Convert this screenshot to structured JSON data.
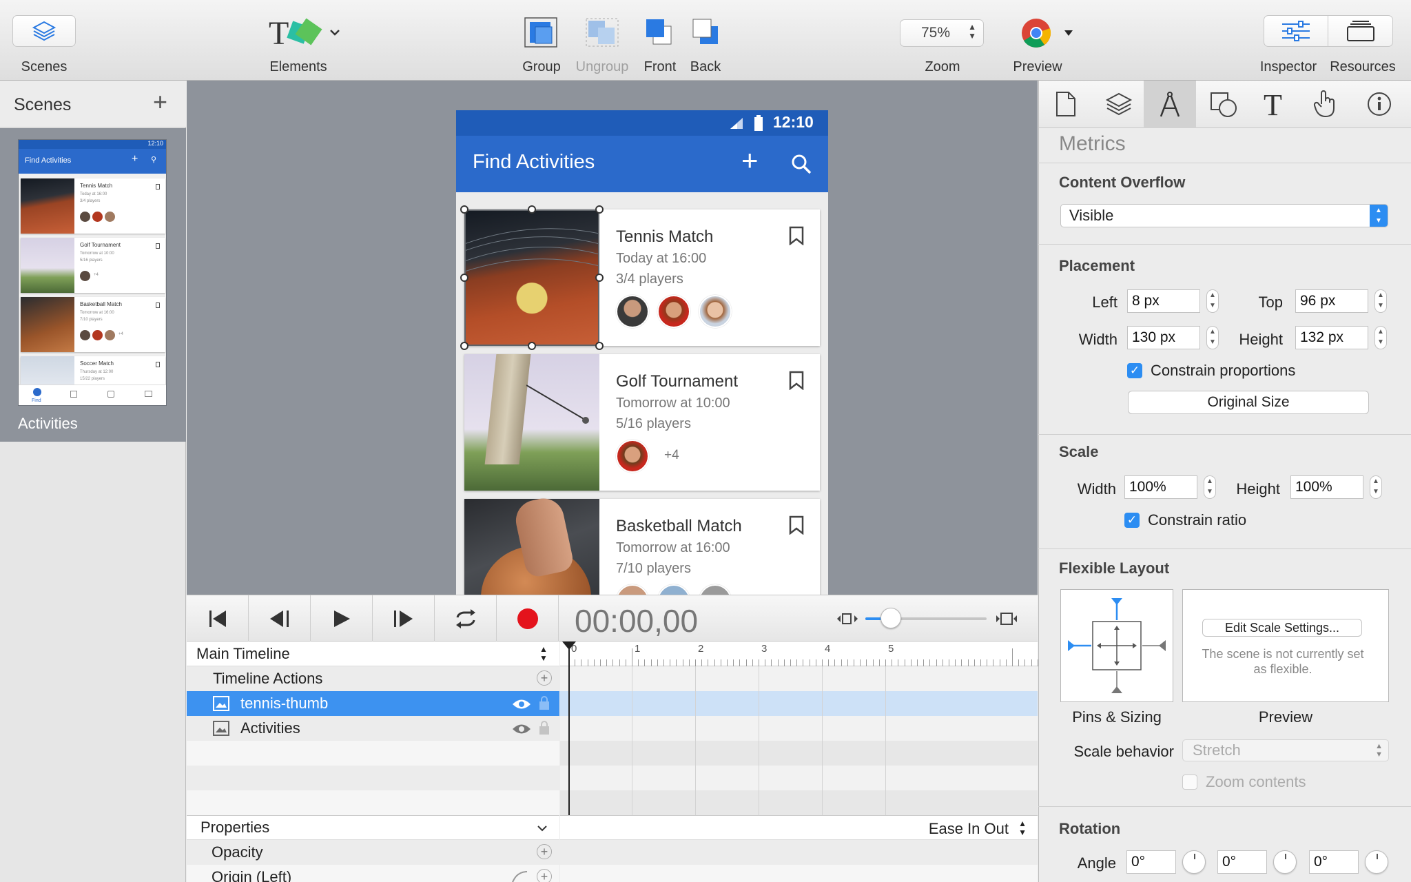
{
  "toolbar": {
    "scenes": "Scenes",
    "elements": "Elements",
    "group": "Group",
    "ungroup": "Ungroup",
    "front": "Front",
    "back": "Back",
    "zoom_value": "75%",
    "zoom": "Zoom",
    "preview": "Preview",
    "inspector": "Inspector",
    "resources": "Resources"
  },
  "scenes_panel": {
    "title": "Scenes",
    "scene_name": "Activities"
  },
  "thumbnail": {
    "app_title": "Find Activities",
    "time": "12:10",
    "cards": [
      {
        "title": "Tennis Match",
        "when": "Today at 16:00",
        "players": "3/4 players"
      },
      {
        "title": "Golf Tournament",
        "when": "Tomorrow at 10:00",
        "players": "5/16 players",
        "extra": "+4"
      },
      {
        "title": "Basketball Match",
        "when": "Tomorrow at 16:00",
        "players": "7/10 players",
        "extra": "+4"
      },
      {
        "title": "Soccer Match",
        "when": "Thursday at 12:00",
        "players": "15/22 players"
      }
    ],
    "nav": [
      "Find"
    ]
  },
  "phone": {
    "time": "12:10",
    "app_title": "Find Activities",
    "cards": [
      {
        "title": "Tennis Match",
        "when": "Today at 16:00",
        "players": "3/4 players"
      },
      {
        "title": "Golf Tournament",
        "when": "Tomorrow at 10:00",
        "players": "5/16 players",
        "extra": "+4"
      },
      {
        "title": "Basketball Match",
        "when": "Tomorrow at 16:00",
        "players": "7/10 players"
      }
    ]
  },
  "timeline": {
    "timecode": "00:00,00",
    "main_timeline": "Main Timeline",
    "timeline_actions": "Timeline Actions",
    "layers": [
      "tennis-thumb",
      "Activities"
    ],
    "ruler": [
      "0",
      "1",
      "2",
      "3",
      "4",
      "5"
    ],
    "properties": "Properties",
    "easing": "Ease In Out",
    "props": [
      "Opacity",
      "Origin (Left)"
    ]
  },
  "inspector": {
    "section_metrics": "Metrics",
    "content_overflow": "Content Overflow",
    "overflow_value": "Visible",
    "placement": "Placement",
    "left_label": "Left",
    "left_value": "8 px",
    "top_label": "Top",
    "top_value": "96 px",
    "width_label": "Width",
    "width_value": "130 px",
    "height_label": "Height",
    "height_value": "132 px",
    "constrain_proportions": "Constrain proportions",
    "original_size": "Original Size",
    "scale": "Scale",
    "scale_width_label": "Width",
    "scale_width_value": "100%",
    "scale_height_label": "Height",
    "scale_height_value": "100%",
    "constrain_ratio": "Constrain ratio",
    "flexible_layout": "Flexible Layout",
    "edit_scale": "Edit Scale Settings...",
    "not_flexible": "The scene is not currently set as flexible.",
    "pins_sizing": "Pins & Sizing",
    "preview": "Preview",
    "scale_behavior": "Scale behavior",
    "scale_behavior_value": "Stretch",
    "zoom_contents": "Zoom contents",
    "rotation": "Rotation",
    "angle": "Angle",
    "angle_values": [
      "0°",
      "0°",
      "0°"
    ]
  },
  "colors": {
    "accent_blue": "#2b6acb",
    "selection": "#4a90e2",
    "record_red": "#e4131c",
    "canvas_gray": "#8e939b"
  }
}
